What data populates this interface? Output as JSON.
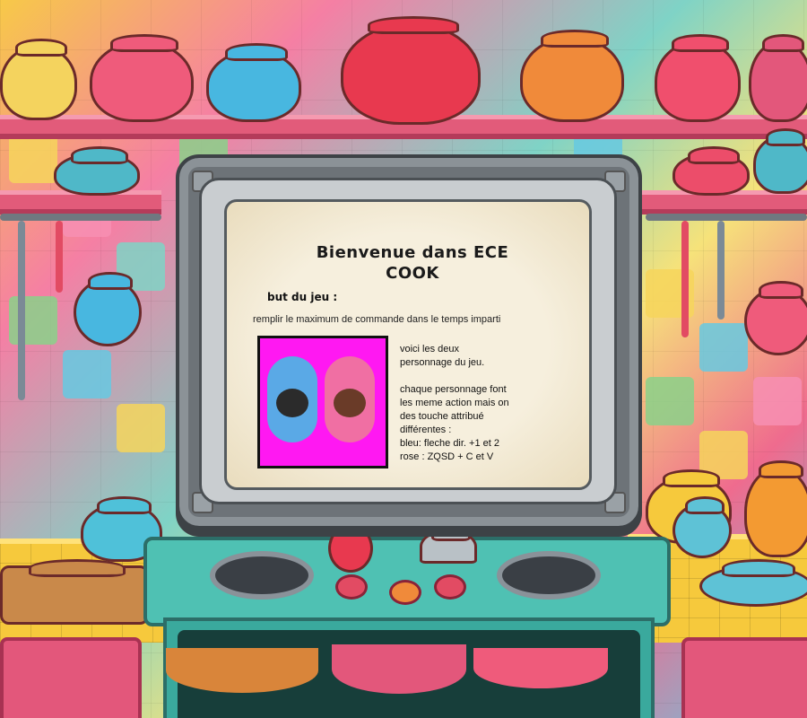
{
  "welcome": {
    "title_line1": "Bienvenue dans ECE",
    "title_line2": "COOK",
    "goal_label": "but du jeu :",
    "goal_text": "remplir le maximum de commande dans le temps imparti"
  },
  "characters": {
    "intro_line1": "voici les deux",
    "intro_line2": "personnage du jeu.",
    "rules_line1": "chaque personnage font",
    "rules_line2": "les meme action mais on",
    "rules_line3": "des touche attribué",
    "rules_line4": "différentes :",
    "blue_controls": "bleu: fleche dir. +1 et 2",
    "pink_controls": "rose : ZQSD + C et V"
  },
  "colors": {
    "character_background": "#ff18f2",
    "blue_character": "#5aa9e6",
    "pink_character": "#f06fa3"
  }
}
